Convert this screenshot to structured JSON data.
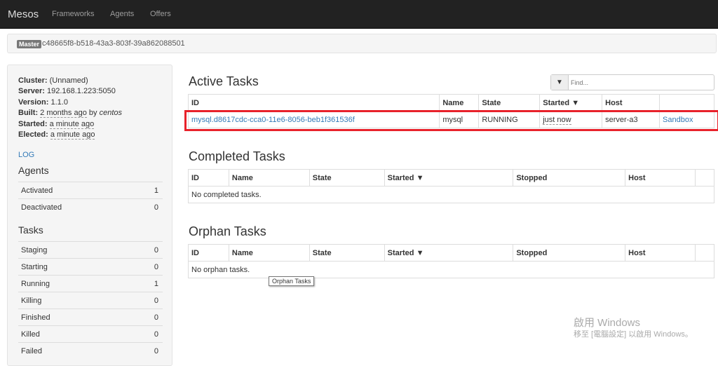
{
  "navbar": {
    "brand": "Mesos",
    "links": [
      "Frameworks",
      "Agents",
      "Offers"
    ]
  },
  "master_bar": {
    "badge": "Master",
    "id": "c48665f8-b518-43a3-803f-39a862088501"
  },
  "sidebar": {
    "info": [
      {
        "key": "Cluster:",
        "value": "(Unnamed)"
      },
      {
        "key": "Server:",
        "value": "192.168.1.223:5050"
      },
      {
        "key": "Version:",
        "value": "1.1.0"
      },
      {
        "key": "Built:",
        "value": "2 months ago",
        "suffix_by": "by",
        "suffix_user": "centos"
      },
      {
        "key": "Started:",
        "value": "a minute ago"
      },
      {
        "key": "Elected:",
        "value": "a minute ago"
      }
    ],
    "log_link": "LOG",
    "agents_heading": "Agents",
    "agents": [
      {
        "label": "Activated",
        "count": "1"
      },
      {
        "label": "Deactivated",
        "count": "0"
      }
    ],
    "tasks_heading": "Tasks",
    "tasks": [
      {
        "label": "Staging",
        "count": "0"
      },
      {
        "label": "Starting",
        "count": "0"
      },
      {
        "label": "Running",
        "count": "1"
      },
      {
        "label": "Killing",
        "count": "0"
      },
      {
        "label": "Finished",
        "count": "0"
      },
      {
        "label": "Killed",
        "count": "0"
      },
      {
        "label": "Failed",
        "count": "0"
      }
    ]
  },
  "find": {
    "icon": "filter-icon",
    "placeholder": "Find..."
  },
  "active": {
    "title": "Active Tasks",
    "headers": [
      "ID",
      "Name",
      "State",
      "Started ▼",
      "Host",
      ""
    ],
    "rows": [
      {
        "id": "mysql.d8617cdc-cca0-11e6-8056-beb1f361536f",
        "name": "mysql",
        "state": "RUNNING",
        "started": "just now",
        "host": "server-a3",
        "sandbox": "Sandbox"
      }
    ]
  },
  "completed": {
    "title": "Completed Tasks",
    "headers": [
      "ID",
      "Name",
      "State",
      "Started ▼",
      "Stopped",
      "Host",
      ""
    ],
    "empty": "No completed tasks."
  },
  "orphan": {
    "title": "Orphan Tasks",
    "headers": [
      "ID",
      "Name",
      "State",
      "Started ▼",
      "Stopped",
      "Host",
      ""
    ],
    "empty": "No orphan tasks."
  },
  "tooltip": "Orphan Tasks",
  "watermark": {
    "line1": "啟用 Windows",
    "line2": "移至 [電腦設定] 以啟用 Windows。"
  },
  "colors": {
    "highlight": "#e8222b",
    "link": "#337ab7",
    "navbar": "#222222"
  }
}
